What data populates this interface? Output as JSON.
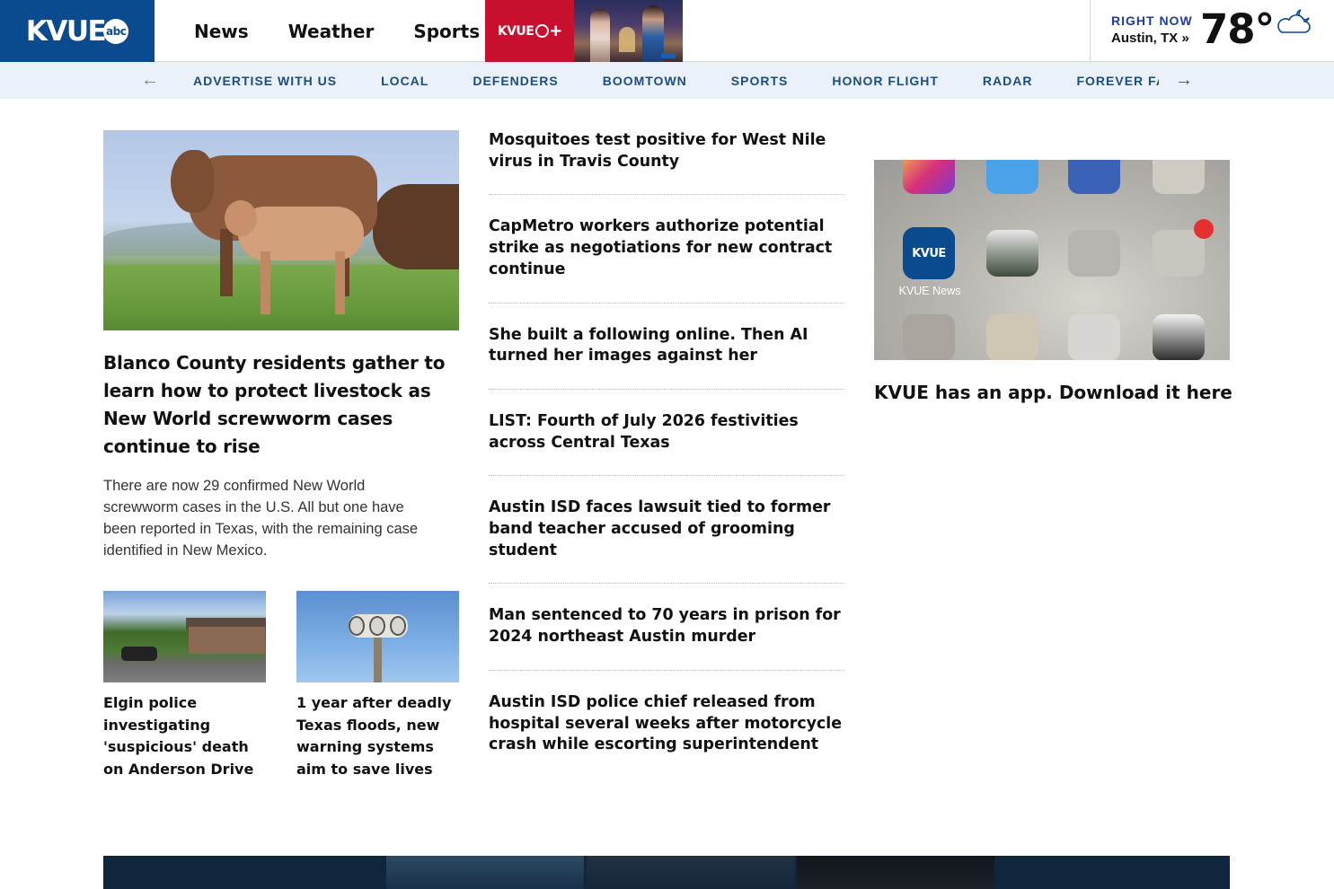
{
  "header": {
    "logo": "KVUE",
    "logo_badge": "abc",
    "nav": [
      "News",
      "Weather",
      "Sports"
    ],
    "plus_label": "KVUE",
    "plus_sign": "+"
  },
  "weather": {
    "label": "RIGHT NOW",
    "location": "Austin, TX »",
    "temperature": "78°",
    "icon": "partly-cloudy-night-icon"
  },
  "subnav": {
    "items": [
      "ADVERTISE WITH US",
      "LOCAL",
      "DEFENDERS",
      "BOOMTOWN",
      "SPORTS",
      "HONOR FLIGHT",
      "RADAR",
      "FOREVER FAMILIES"
    ],
    "prev_arrow": "←",
    "next_arrow": "→"
  },
  "lead": {
    "headline": "Blanco County residents gather to learn how to protect livestock as New World screwworm cases continue to rise",
    "summary": "There are now 29 confirmed New World screwworm cases in the U.S. All but one have been reported in Texas, with the remaining case identified in New Mexico."
  },
  "small_stories": [
    {
      "title": "Elgin police investigating 'suspicious' death on Anderson Drive"
    },
    {
      "title": "1 year after deadly Texas floods, new warning systems aim to save lives"
    }
  ],
  "headlines": [
    "Mosquitoes test positive for West Nile virus in Travis County",
    "CapMetro workers authorize potential strike as negotiations for new contract continue",
    "She built a following online. Then AI turned her images against her",
    "LIST: Fourth of July 2026 festivities across Central Texas",
    "Austin ISD faces lawsuit tied to former band teacher accused of grooming student",
    "Man sentenced to 70 years in prison for 2024 northeast Austin murder",
    "Austin ISD police chief released from hospital several weeks after motorcycle crash while escorting superintendent"
  ],
  "app_promo": {
    "app_label": "KVUE News",
    "app_icon_text": "KVUE",
    "headline": "KVUE has an app. Download it here"
  },
  "colors": {
    "brand_blue": "#0a4a8f",
    "plus_red": "#c8102e",
    "subnav_bg": "#eaf1f8",
    "subnav_text": "#1d4d80",
    "right_now": "#1d3ea0"
  }
}
